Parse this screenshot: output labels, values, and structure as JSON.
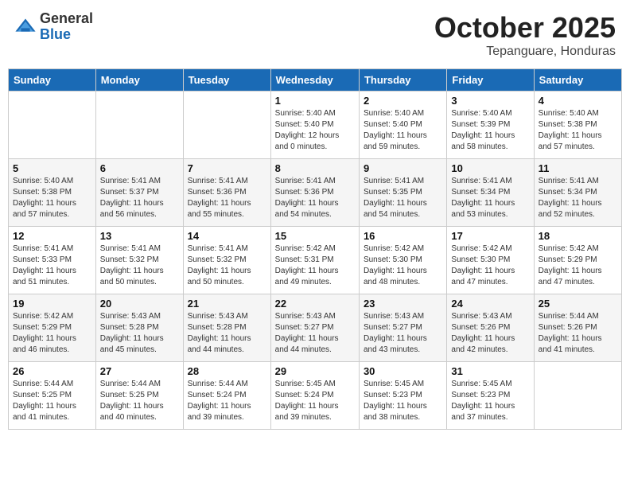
{
  "header": {
    "logo_general": "General",
    "logo_blue": "Blue",
    "month_title": "October 2025",
    "subtitle": "Tepanguare, Honduras"
  },
  "weekdays": [
    "Sunday",
    "Monday",
    "Tuesday",
    "Wednesday",
    "Thursday",
    "Friday",
    "Saturday"
  ],
  "weeks": [
    [
      {
        "day": "",
        "info": ""
      },
      {
        "day": "",
        "info": ""
      },
      {
        "day": "",
        "info": ""
      },
      {
        "day": "1",
        "info": "Sunrise: 5:40 AM\nSunset: 5:40 PM\nDaylight: 12 hours\nand 0 minutes."
      },
      {
        "day": "2",
        "info": "Sunrise: 5:40 AM\nSunset: 5:40 PM\nDaylight: 11 hours\nand 59 minutes."
      },
      {
        "day": "3",
        "info": "Sunrise: 5:40 AM\nSunset: 5:39 PM\nDaylight: 11 hours\nand 58 minutes."
      },
      {
        "day": "4",
        "info": "Sunrise: 5:40 AM\nSunset: 5:38 PM\nDaylight: 11 hours\nand 57 minutes."
      }
    ],
    [
      {
        "day": "5",
        "info": "Sunrise: 5:40 AM\nSunset: 5:38 PM\nDaylight: 11 hours\nand 57 minutes."
      },
      {
        "day": "6",
        "info": "Sunrise: 5:41 AM\nSunset: 5:37 PM\nDaylight: 11 hours\nand 56 minutes."
      },
      {
        "day": "7",
        "info": "Sunrise: 5:41 AM\nSunset: 5:36 PM\nDaylight: 11 hours\nand 55 minutes."
      },
      {
        "day": "8",
        "info": "Sunrise: 5:41 AM\nSunset: 5:36 PM\nDaylight: 11 hours\nand 54 minutes."
      },
      {
        "day": "9",
        "info": "Sunrise: 5:41 AM\nSunset: 5:35 PM\nDaylight: 11 hours\nand 54 minutes."
      },
      {
        "day": "10",
        "info": "Sunrise: 5:41 AM\nSunset: 5:34 PM\nDaylight: 11 hours\nand 53 minutes."
      },
      {
        "day": "11",
        "info": "Sunrise: 5:41 AM\nSunset: 5:34 PM\nDaylight: 11 hours\nand 52 minutes."
      }
    ],
    [
      {
        "day": "12",
        "info": "Sunrise: 5:41 AM\nSunset: 5:33 PM\nDaylight: 11 hours\nand 51 minutes."
      },
      {
        "day": "13",
        "info": "Sunrise: 5:41 AM\nSunset: 5:32 PM\nDaylight: 11 hours\nand 50 minutes."
      },
      {
        "day": "14",
        "info": "Sunrise: 5:41 AM\nSunset: 5:32 PM\nDaylight: 11 hours\nand 50 minutes."
      },
      {
        "day": "15",
        "info": "Sunrise: 5:42 AM\nSunset: 5:31 PM\nDaylight: 11 hours\nand 49 minutes."
      },
      {
        "day": "16",
        "info": "Sunrise: 5:42 AM\nSunset: 5:30 PM\nDaylight: 11 hours\nand 48 minutes."
      },
      {
        "day": "17",
        "info": "Sunrise: 5:42 AM\nSunset: 5:30 PM\nDaylight: 11 hours\nand 47 minutes."
      },
      {
        "day": "18",
        "info": "Sunrise: 5:42 AM\nSunset: 5:29 PM\nDaylight: 11 hours\nand 47 minutes."
      }
    ],
    [
      {
        "day": "19",
        "info": "Sunrise: 5:42 AM\nSunset: 5:29 PM\nDaylight: 11 hours\nand 46 minutes."
      },
      {
        "day": "20",
        "info": "Sunrise: 5:43 AM\nSunset: 5:28 PM\nDaylight: 11 hours\nand 45 minutes."
      },
      {
        "day": "21",
        "info": "Sunrise: 5:43 AM\nSunset: 5:28 PM\nDaylight: 11 hours\nand 44 minutes."
      },
      {
        "day": "22",
        "info": "Sunrise: 5:43 AM\nSunset: 5:27 PM\nDaylight: 11 hours\nand 44 minutes."
      },
      {
        "day": "23",
        "info": "Sunrise: 5:43 AM\nSunset: 5:27 PM\nDaylight: 11 hours\nand 43 minutes."
      },
      {
        "day": "24",
        "info": "Sunrise: 5:43 AM\nSunset: 5:26 PM\nDaylight: 11 hours\nand 42 minutes."
      },
      {
        "day": "25",
        "info": "Sunrise: 5:44 AM\nSunset: 5:26 PM\nDaylight: 11 hours\nand 41 minutes."
      }
    ],
    [
      {
        "day": "26",
        "info": "Sunrise: 5:44 AM\nSunset: 5:25 PM\nDaylight: 11 hours\nand 41 minutes."
      },
      {
        "day": "27",
        "info": "Sunrise: 5:44 AM\nSunset: 5:25 PM\nDaylight: 11 hours\nand 40 minutes."
      },
      {
        "day": "28",
        "info": "Sunrise: 5:44 AM\nSunset: 5:24 PM\nDaylight: 11 hours\nand 39 minutes."
      },
      {
        "day": "29",
        "info": "Sunrise: 5:45 AM\nSunset: 5:24 PM\nDaylight: 11 hours\nand 39 minutes."
      },
      {
        "day": "30",
        "info": "Sunrise: 5:45 AM\nSunset: 5:23 PM\nDaylight: 11 hours\nand 38 minutes."
      },
      {
        "day": "31",
        "info": "Sunrise: 5:45 AM\nSunset: 5:23 PM\nDaylight: 11 hours\nand 37 minutes."
      },
      {
        "day": "",
        "info": ""
      }
    ]
  ]
}
